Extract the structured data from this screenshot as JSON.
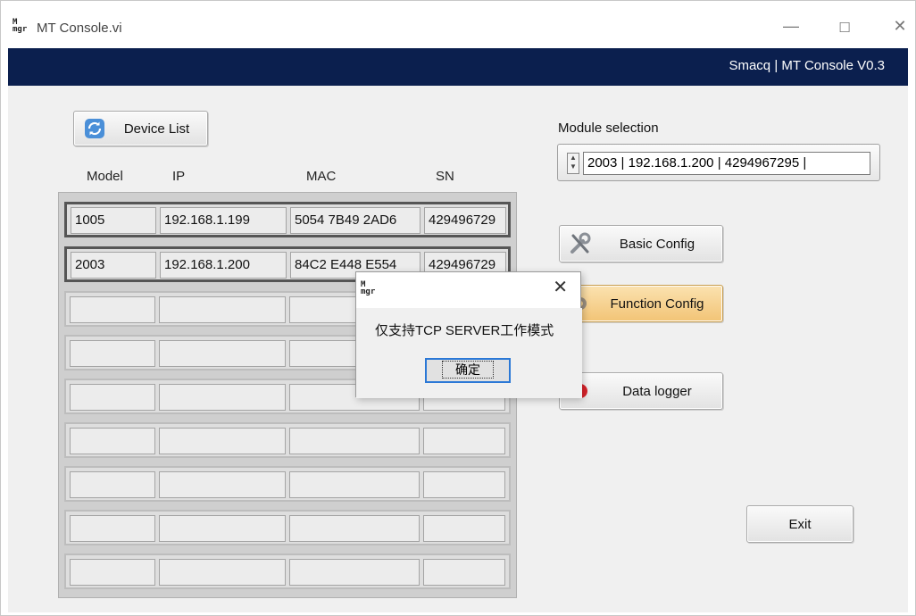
{
  "window": {
    "title": "MT Console.vi",
    "icon_text": "M\nmgr",
    "minimize": "—",
    "maximize": "☐",
    "close": "✕"
  },
  "banner": {
    "text": "Smacq | MT Console V0.3"
  },
  "device_list_button": {
    "label": "Device List",
    "icon": "refresh-icon"
  },
  "columns": [
    "Model",
    "IP",
    "MAC",
    "SN"
  ],
  "rows": [
    {
      "model": "1005",
      "ip": "192.168.1.199",
      "mac": "5054 7B49 2AD6",
      "sn": "429496729"
    },
    {
      "model": "2003",
      "ip": "192.168.1.200",
      "mac": "84C2 E448 E554",
      "sn": "429496729"
    },
    {
      "model": "",
      "ip": "",
      "mac": "",
      "sn": ""
    },
    {
      "model": "",
      "ip": "",
      "mac": "",
      "sn": ""
    },
    {
      "model": "",
      "ip": "",
      "mac": "",
      "sn": ""
    },
    {
      "model": "",
      "ip": "",
      "mac": "",
      "sn": ""
    },
    {
      "model": "",
      "ip": "",
      "mac": "",
      "sn": ""
    },
    {
      "model": "",
      "ip": "",
      "mac": "",
      "sn": ""
    },
    {
      "model": "",
      "ip": "",
      "mac": "",
      "sn": ""
    }
  ],
  "module_selection": {
    "label": "Module selection",
    "value": "2003 | 192.168.1.200 | 4294967295 |"
  },
  "buttons": {
    "basic_config": "Basic Config",
    "function_config": "Function Config",
    "data_logger": "Data logger",
    "exit": "Exit"
  },
  "dialog": {
    "icon_text": "M\nmgr",
    "close": "✕",
    "message": "仅支持TCP SERVER工作模式",
    "ok": "确定"
  },
  "colors": {
    "banner": "#0b1f4e",
    "function_config_bg": "#f6d28c",
    "focus_border": "#2b78d6"
  }
}
